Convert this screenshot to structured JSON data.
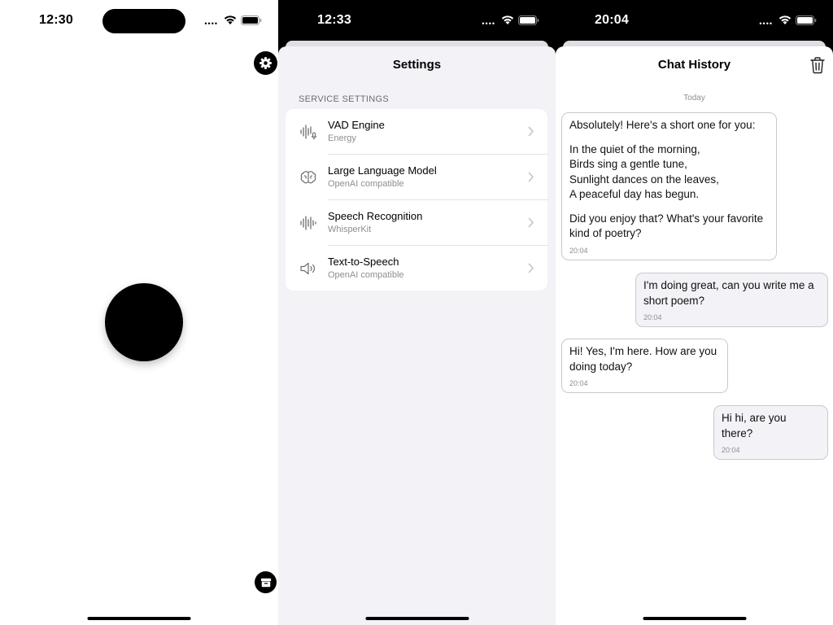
{
  "screen1": {
    "status": {
      "time": "12:30"
    }
  },
  "screen2": {
    "status": {
      "time": "12:33"
    },
    "title": "Settings",
    "section_header": "SERVICE SETTINGS",
    "rows": [
      {
        "icon": "waveform-mic-icon",
        "title": "VAD Engine",
        "subtitle": "Energy"
      },
      {
        "icon": "brain-icon",
        "title": "Large Language Model",
        "subtitle": "OpenAI compatible"
      },
      {
        "icon": "waveform-icon",
        "title": "Speech Recognition",
        "subtitle": "WhisperKit"
      },
      {
        "icon": "speaker-icon",
        "title": "Text-to-Speech",
        "subtitle": "OpenAI compatible"
      }
    ]
  },
  "screen3": {
    "status": {
      "time": "20:04"
    },
    "title": "Chat History",
    "date_separator": "Today",
    "messages": [
      {
        "role": "assistant",
        "paragraphs": [
          "Absolutely! Here's a short one for you:",
          "In the quiet of the morning,\nBirds sing a gentle tune,\nSunlight dances on the leaves,\nA peaceful day has begun.",
          "Did you enjoy that? What's your favorite kind of poetry?"
        ],
        "time": "20:04"
      },
      {
        "role": "user",
        "paragraphs": [
          "I'm doing great, can you write me a short poem?"
        ],
        "time": "20:04"
      },
      {
        "role": "assistant",
        "paragraphs": [
          "Hi! Yes, I'm here. How are you doing today?"
        ],
        "time": "20:04"
      },
      {
        "role": "user",
        "paragraphs": [
          "Hi hi, are you there?"
        ],
        "time": "20:04"
      }
    ]
  }
}
